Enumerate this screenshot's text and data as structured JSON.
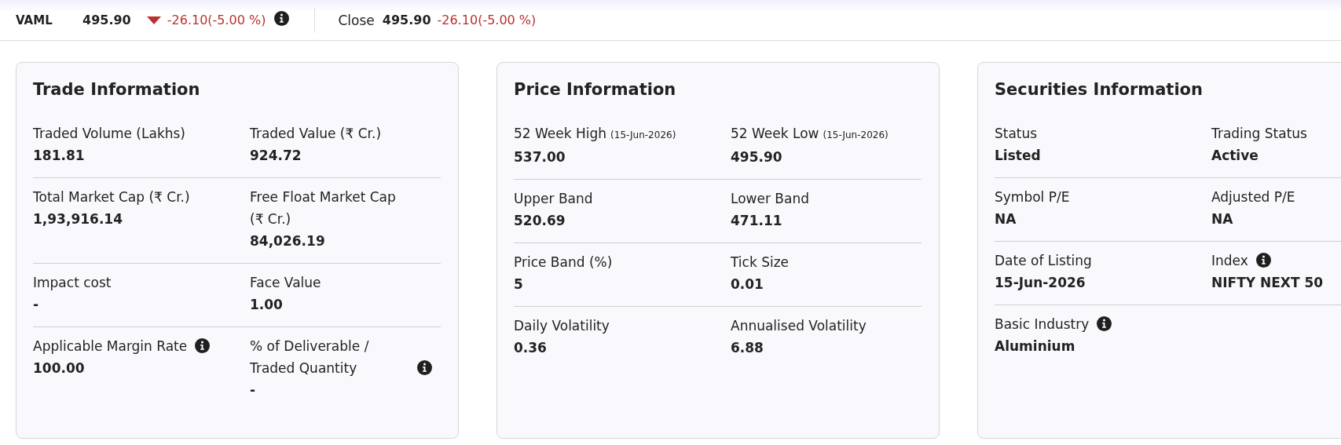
{
  "header": {
    "symbol": "VAML",
    "price": "495.90",
    "falling": true,
    "change": "-26.10(-5.00 %)",
    "info": true,
    "close_label": "Close",
    "close_price": "495.90",
    "close_change": "-26.10(-5.00 %)"
  },
  "cards": [
    {
      "title": "Trade Information",
      "rows": [
        [
          {
            "label": "Traded Volume (Lakhs)",
            "value": "181.81"
          },
          {
            "label": "Traded Value (₹ Cr.)",
            "value": "924.72"
          }
        ],
        [
          {
            "label": "Total Market Cap (₹ Cr.)",
            "value": "1,93,916.14"
          },
          {
            "label": "Free Float Market Cap (₹ Cr.)",
            "value": "84,026.19"
          }
        ],
        [
          {
            "label": "Impact cost",
            "value": "-"
          },
          {
            "label": "Face Value",
            "value": "1.00"
          }
        ],
        [
          {
            "label": "Applicable Margin Rate",
            "info": true,
            "value": "100.00"
          },
          {
            "label": "% of Deliverable / Traded Quantity",
            "info": true,
            "value": "-"
          }
        ]
      ]
    },
    {
      "title": "Price Information",
      "rows": [
        [
          {
            "label": "52 Week High",
            "note": "(15-Jun-2026)",
            "value": "537.00"
          },
          {
            "label": "52 Week Low",
            "note": "(15-Jun-2026)",
            "value": "495.90"
          }
        ],
        [
          {
            "label": "Upper Band",
            "value": "520.69"
          },
          {
            "label": "Lower Band",
            "value": "471.11"
          }
        ],
        [
          {
            "label": "Price Band (%)",
            "value": "5"
          },
          {
            "label": "Tick Size",
            "value": "0.01"
          }
        ],
        [
          {
            "label": "Daily Volatility",
            "value": "0.36"
          },
          {
            "label": "Annualised Volatility",
            "value": "6.88"
          }
        ]
      ]
    },
    {
      "title": "Securities Information",
      "rows": [
        [
          {
            "label": "Status",
            "value": "Listed"
          },
          {
            "label": "Trading Status",
            "value": "Active"
          }
        ],
        [
          {
            "label": "Symbol P/E",
            "value": "NA"
          },
          {
            "label": "Adjusted P/E",
            "value": "NA"
          }
        ],
        [
          {
            "label": "Date of Listing",
            "value": "15-Jun-2026"
          },
          {
            "label": "Index",
            "info": true,
            "value": "NIFTY NEXT 50"
          }
        ],
        [
          {
            "label": "Basic Industry",
            "info": true,
            "value": "Aluminium"
          }
        ]
      ]
    }
  ]
}
